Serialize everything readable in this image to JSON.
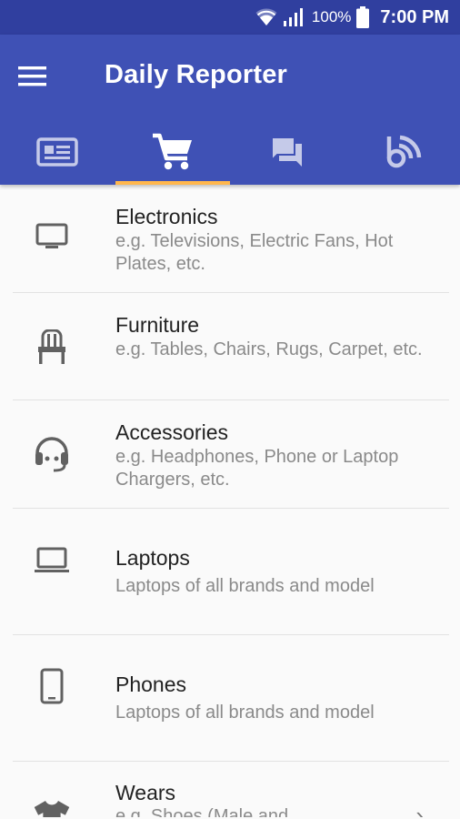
{
  "status_bar": {
    "battery_percent": "100%",
    "time": "7:00 PM",
    "icons": [
      "wifi-icon",
      "signal-icon",
      "battery-icon"
    ]
  },
  "app_bar": {
    "title": "Daily Reporter",
    "menu_icon": "hamburger-menu-icon"
  },
  "tabs": [
    {
      "icon": "newspaper-icon",
      "active": false
    },
    {
      "icon": "shopping-cart-icon",
      "active": true
    },
    {
      "icon": "chat-icon",
      "active": false
    },
    {
      "icon": "blog-icon",
      "active": false
    }
  ],
  "categories": [
    {
      "icon": "tv-icon",
      "title": "Electronics",
      "subtitle": "e.g. Televisions, Electric Fans, Hot Plates, etc."
    },
    {
      "icon": "chair-icon",
      "title": "Furniture",
      "subtitle": "e.g. Tables, Chairs, Rugs, Carpet, etc."
    },
    {
      "icon": "headset-icon",
      "title": "Accessories",
      "subtitle": "e.g. Headphones, Phone or Laptop Chargers, etc."
    },
    {
      "icon": "laptop-icon",
      "title": "Laptops",
      "subtitle": "Laptops of all brands and model"
    },
    {
      "icon": "phone-icon",
      "title": "Phones",
      "subtitle": "Laptops of all brands and model"
    },
    {
      "icon": "tshirt-icon",
      "title": "Wears",
      "subtitle": "e.g. Shoes (Male and"
    }
  ],
  "colors": {
    "app_bar": "#3f51b5",
    "status_bar": "#303f9f",
    "tab_indicator": "#ffb74d",
    "icon_gray": "#616161"
  }
}
